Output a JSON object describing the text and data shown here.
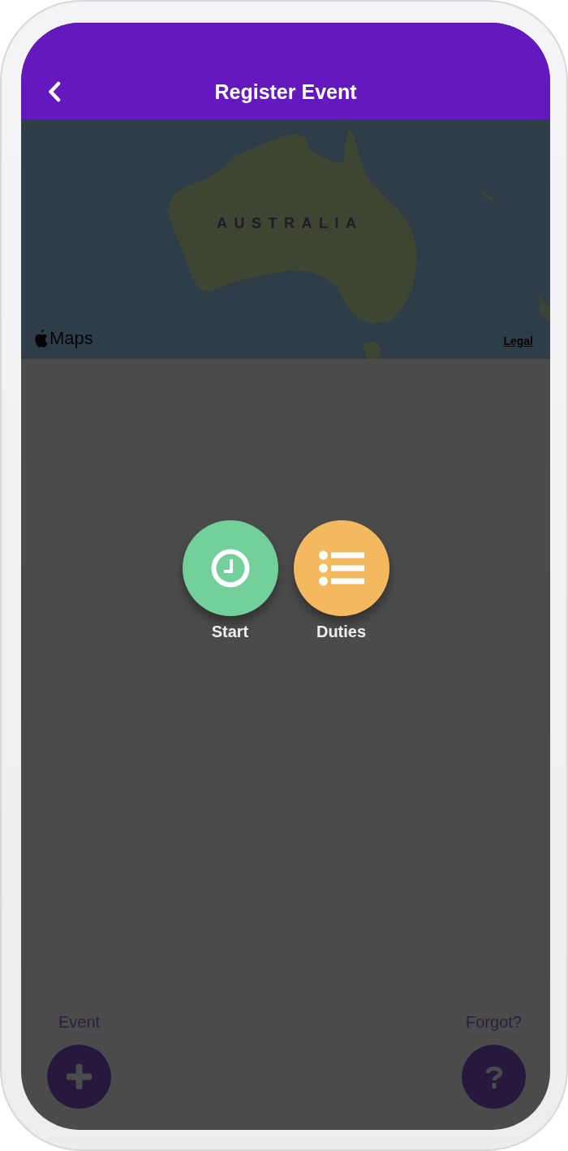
{
  "header": {
    "title": "Register Event"
  },
  "map": {
    "label": "AUSTRALIA",
    "attribution": "Maps",
    "legal_link": "Legal"
  },
  "actions": [
    {
      "label": "Start",
      "kind": "clock",
      "color": "#74d09a"
    },
    {
      "label": "Duties",
      "kind": "list",
      "color": "#f4b95e"
    }
  ],
  "bottom_actions": [
    {
      "label": "Event",
      "kind": "add"
    },
    {
      "label": "Forgot?",
      "kind": "help"
    }
  ]
}
